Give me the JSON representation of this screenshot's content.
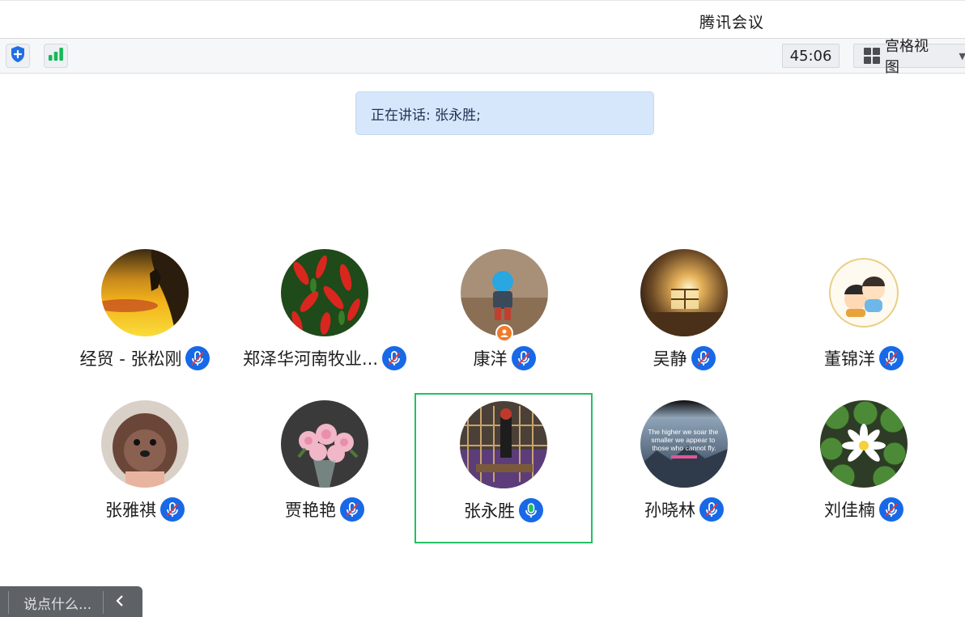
{
  "window": {
    "title": "腾讯会议"
  },
  "toolbar": {
    "timer": "45:06",
    "view_label": "宫格视图",
    "icons": [
      "shield-icon",
      "signal-icon",
      "grid-view-icon",
      "caret-down-icon"
    ]
  },
  "speaking": {
    "text": "正在讲话: 张永胜;"
  },
  "participants": [
    {
      "name": "经贸 - 张松刚",
      "mic": "muted"
    },
    {
      "name": "郑泽华河南牧业...",
      "mic": "muted"
    },
    {
      "name": "康洋",
      "mic": "muted",
      "host": true
    },
    {
      "name": "吴静",
      "mic": "muted"
    },
    {
      "name": "董锦洋",
      "mic": "muted"
    },
    {
      "name": "张雅祺",
      "mic": "muted"
    },
    {
      "name": "贾艳艳",
      "mic": "muted"
    },
    {
      "name": "张永胜",
      "mic": "speaking",
      "active": true
    },
    {
      "name": "孙晓林",
      "mic": "muted"
    },
    {
      "name": "刘佳楠",
      "mic": "muted"
    }
  ],
  "avatar_texts": {
    "sun_xiaolin": "The higher we soar the smaller we appear to those who cannot fly."
  },
  "chat": {
    "placeholder": "说点什么..."
  },
  "colors": {
    "mic_blue": "#1769e8",
    "speaking_green": "#21c15f",
    "active_border": "#22c066",
    "banner_bg": "#d7e7fb"
  }
}
